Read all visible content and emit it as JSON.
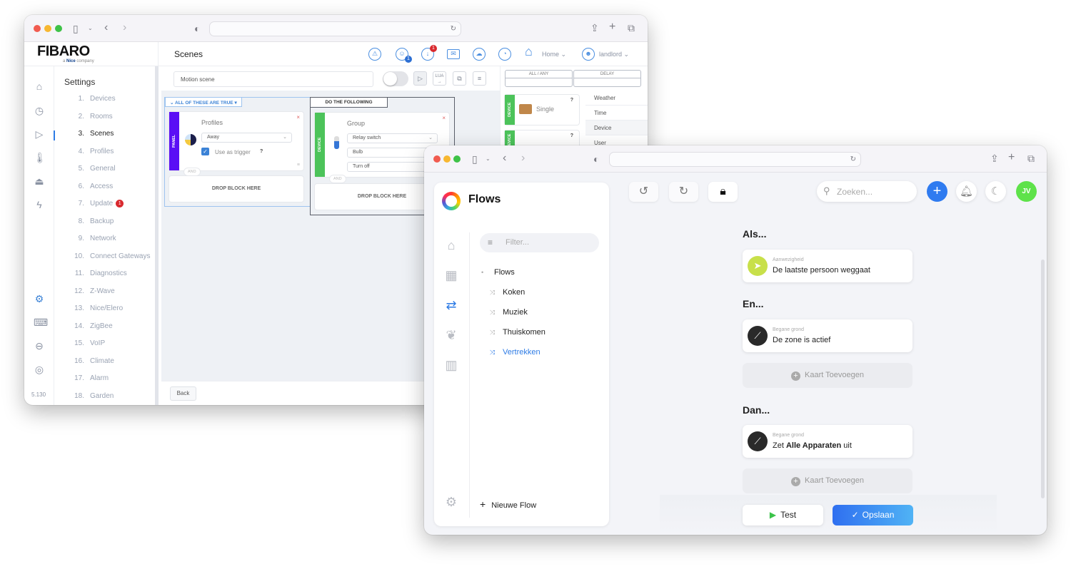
{
  "fibaro_window": {
    "logo": "FIBARO",
    "logo_sub_prefix": "a",
    "logo_sub_brand": "Nice",
    "logo_sub_suffix": "company",
    "page_title": "Scenes",
    "notification_badges": {
      "users": "1",
      "updates": "1"
    },
    "home_label": "Home",
    "user_label": "landlord",
    "settings_heading": "Settings",
    "version": "5.130",
    "settings_nav": [
      {
        "num": "1.",
        "label": "Devices"
      },
      {
        "num": "2.",
        "label": "Rooms"
      },
      {
        "num": "3.",
        "label": "Scenes",
        "active": true
      },
      {
        "num": "4.",
        "label": "Profiles"
      },
      {
        "num": "5.",
        "label": "General"
      },
      {
        "num": "6.",
        "label": "Access"
      },
      {
        "num": "7.",
        "label": "Update",
        "badge": "1"
      },
      {
        "num": "8.",
        "label": "Backup"
      },
      {
        "num": "9.",
        "label": "Network"
      },
      {
        "num": "10.",
        "label": "Connect Gateways"
      },
      {
        "num": "11.",
        "label": "Diagnostics"
      },
      {
        "num": "12.",
        "label": "Z-Wave"
      },
      {
        "num": "13.",
        "label": "Nice/Elero"
      },
      {
        "num": "14.",
        "label": "ZigBee"
      },
      {
        "num": "15.",
        "label": "VoIP"
      },
      {
        "num": "16.",
        "label": "Climate"
      },
      {
        "num": "17.",
        "label": "Alarm"
      },
      {
        "num": "18.",
        "label": "Garden"
      }
    ],
    "scene_name": "Motion scene",
    "lua_label": "LUA",
    "conditions": {
      "group_label": "ALL OF THESE ARE TRUE",
      "block": {
        "type_tag": "PANEL",
        "title": "Profiles",
        "select_value": "Away",
        "trigger_label": "Use as trigger",
        "trigger_checked": true,
        "help": "?"
      },
      "and_label": "AND",
      "drop_label": "DROP BLOCK HERE"
    },
    "actions": {
      "group_label": "DO THE FOLLOWING",
      "block": {
        "type_tag": "DEVICE",
        "title": "Group",
        "fields": [
          "Relay switch",
          "Bulb",
          "Turn off"
        ]
      },
      "and_label": "AND",
      "drop_label": "DROP BLOCK HERE"
    },
    "right_panel": {
      "headers": [
        "ALL / ANY",
        "DELAY"
      ],
      "blocks": [
        {
          "type_tag": "DEVICE",
          "label": "Single",
          "help": "?"
        },
        {
          "type_tag": "DEVICE",
          "label": "",
          "help": "?"
        }
      ],
      "categories": [
        {
          "label": "Weather"
        },
        {
          "label": "Time"
        },
        {
          "label": "Device",
          "active": true
        },
        {
          "label": "User"
        }
      ]
    },
    "back_button": "Back"
  },
  "flows_window": {
    "app_title": "Flows",
    "filter_placeholder": "Filter...",
    "tree": [
      {
        "label": "Flows",
        "root": true
      },
      {
        "label": "Koken"
      },
      {
        "label": "Muziek"
      },
      {
        "label": "Thuiskomen"
      },
      {
        "label": "Vertrekken",
        "active": true
      }
    ],
    "new_flow": "Nieuwe Flow",
    "search_placeholder": "Zoeken...",
    "avatar_initials": "JV",
    "sections": {
      "if": "Als...",
      "and": "En...",
      "then": "Dan..."
    },
    "cards": {
      "if": {
        "subtitle": "Aanwezigheid",
        "text": "De laatste persoon weggaat"
      },
      "and": {
        "subtitle": "Begane grond",
        "text": "De zone is actief"
      },
      "then": {
        "subtitle": "Begane grond",
        "text_pre": "Zet",
        "text_bold": "Alle Apparaten",
        "text_post": "uit"
      }
    },
    "add_card": "Kaart Toevoegen",
    "test_button": "Test",
    "save_button": "Opslaan",
    "colors": {
      "accent": "#2d7be5",
      "avatar": "#5ee24a",
      "presence": "#c8e04a",
      "test_play": "#3cc34a"
    }
  }
}
